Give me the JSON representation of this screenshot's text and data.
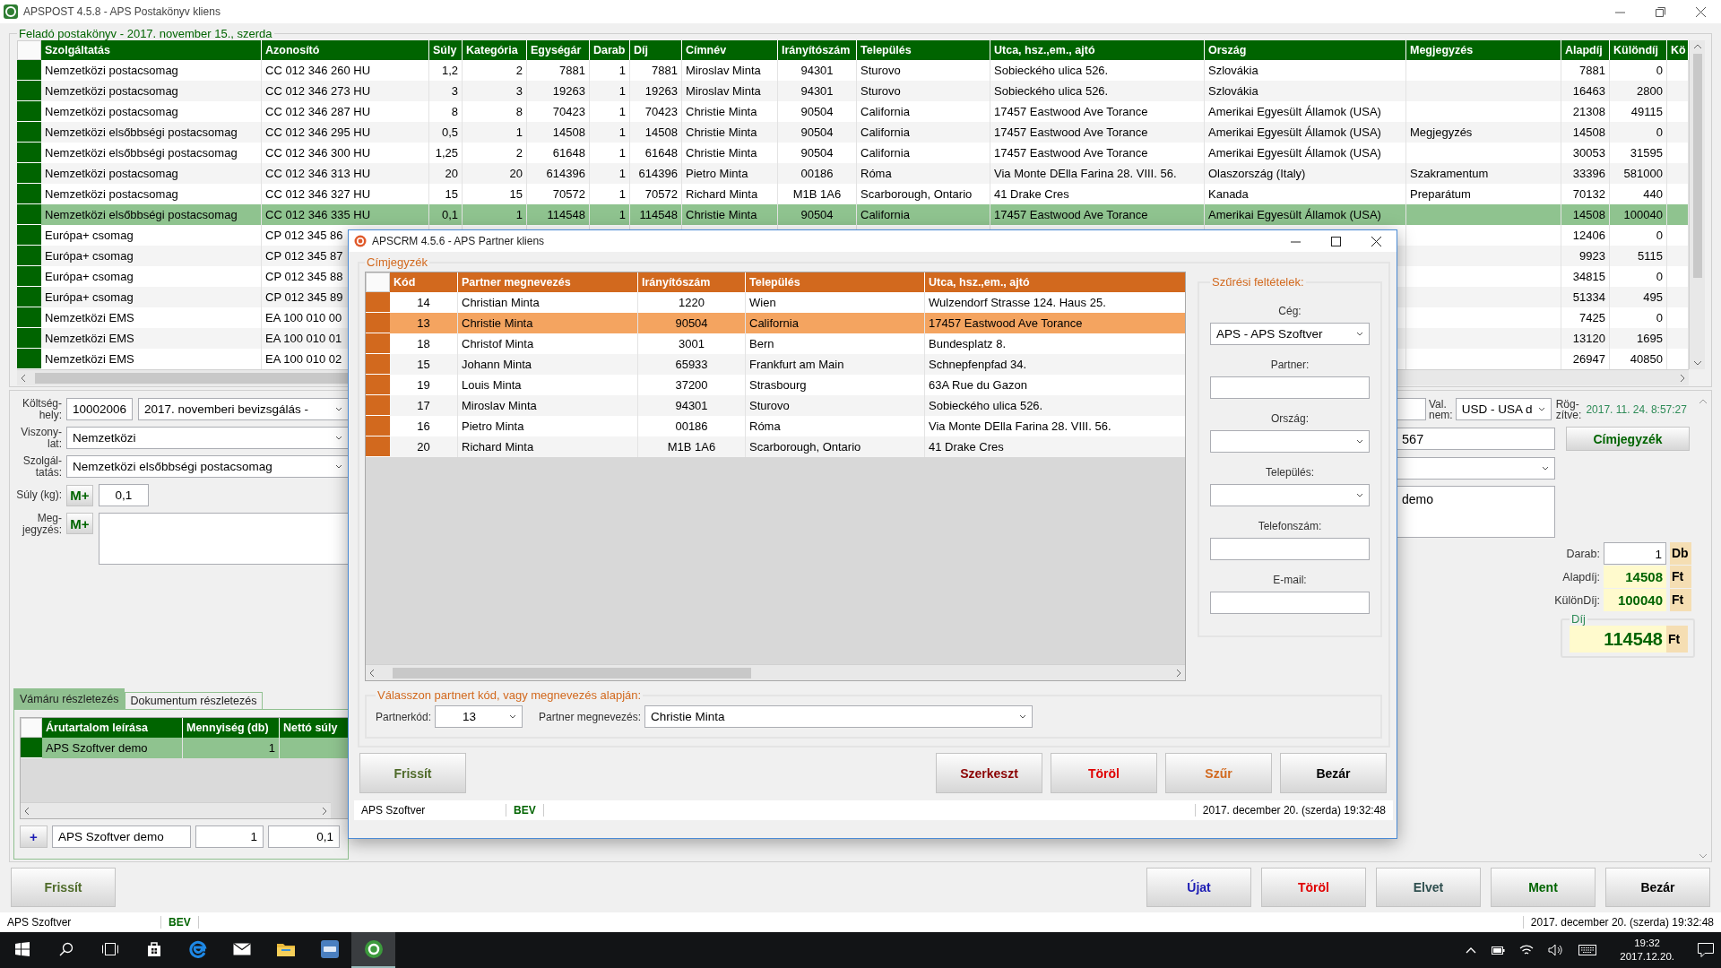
{
  "main": {
    "title": "APSPOST 4.5.8 - APS Postakönyv kliens",
    "ledger": {
      "title": "Feladó postakönyv - 2017. november 15., szerda",
      "columns": [
        "Szolgáltatás",
        "Azonosító",
        "Súly",
        "Kategória",
        "Egységár",
        "Darab",
        "Díj",
        "Címnév",
        "Irányítószám",
        "Település",
        "Utca, hsz.,em., ajtó",
        "Ország",
        "Megjegyzés",
        "Alapdíj",
        "Különdíj",
        "Kö"
      ],
      "rows": [
        {
          "selected": false,
          "cells": [
            "Nemzetközi postacsomag",
            "CC 012 346 260 HU",
            "1,2",
            "2",
            "7881",
            "1",
            "7881",
            "Miroslav Minta",
            "94301",
            "Sturovo",
            "Sobieckého ulica 526.",
            "Szlovákia",
            null,
            "7881",
            "0"
          ]
        },
        {
          "selected": false,
          "cells": [
            "Nemzetközi postacsomag",
            "CC 012 346 273 HU",
            "3",
            "3",
            "19263",
            "1",
            "19263",
            "Miroslav Minta",
            "94301",
            "Sturovo",
            "Sobieckého ulica 526.",
            "Szlovákia",
            null,
            "16463",
            "2800"
          ]
        },
        {
          "selected": false,
          "cells": [
            "Nemzetközi postacsomag",
            "CC 012 346 287 HU",
            "8",
            "8",
            "70423",
            "1",
            "70423",
            "Christie Minta",
            "90504",
            "California",
            "17457 Eastwood Ave Torance",
            "Amerikai Egyesült Államok (USA)",
            null,
            "21308",
            "49115"
          ]
        },
        {
          "selected": false,
          "cells": [
            "Nemzetközi elsőbbségi postacsomag",
            "CC 012 346 295 HU",
            "0,5",
            "1",
            "14508",
            "1",
            "14508",
            "Christie Minta",
            "90504",
            "California",
            "17457 Eastwood Ave Torance",
            "Amerikai Egyesült Államok (USA)",
            "Megjegyzés",
            "14508",
            "0"
          ]
        },
        {
          "selected": false,
          "cells": [
            "Nemzetközi elsőbbségi postacsomag",
            "CC 012 346 300 HU",
            "1,25",
            "2",
            "61648",
            "1",
            "61648",
            "Christie Minta",
            "90504",
            "California",
            "17457 Eastwood Ave Torance",
            "Amerikai Egyesült Államok (USA)",
            null,
            "30053",
            "31595"
          ]
        },
        {
          "selected": false,
          "cells": [
            "Nemzetközi postacsomag",
            "CC 012 346 313 HU",
            "20",
            "20",
            "614396",
            "1",
            "614396",
            "Pietro Minta",
            "00186",
            "Róma",
            "Via Monte DElla Farina 28. VIII. 56.",
            "Olaszország (Italy)",
            "Szakramentum",
            "33396",
            "581000"
          ]
        },
        {
          "selected": false,
          "cells": [
            "Nemzetközi postacsomag",
            "CC 012 346 327 HU",
            "15",
            "15",
            "70572",
            "1",
            "70572",
            "Richard Minta",
            "M1B 1A6",
            "Scarborough, Ontario",
            "41 Drake Cres",
            "Kanada",
            "Preparátum",
            "70132",
            "440"
          ]
        },
        {
          "selected": true,
          "cells": [
            "Nemzetközi elsőbbségi postacsomag",
            "CC 012 346 335 HU",
            "0,1",
            "1",
            "114548",
            "1",
            "114548",
            "Christie Minta",
            "90504",
            "California",
            "17457 Eastwood Ave Torance",
            "Amerikai Egyesült Államok (USA)",
            null,
            "14508",
            "100040"
          ]
        },
        {
          "selected": false,
          "cells": [
            "Európa+ csomag",
            "CP 012 345 86",
            null,
            null,
            null,
            null,
            null,
            null,
            null,
            null,
            null,
            null,
            null,
            "12406",
            "0"
          ]
        },
        {
          "selected": false,
          "cells": [
            "Európa+ csomag",
            "CP 012 345 87",
            null,
            null,
            null,
            null,
            null,
            null,
            null,
            null,
            null,
            null,
            null,
            "9923",
            "5115"
          ]
        },
        {
          "selected": false,
          "cells": [
            "Európa+ csomag",
            "CP 012 345 88",
            null,
            null,
            null,
            null,
            null,
            null,
            null,
            null,
            null,
            null,
            null,
            "34815",
            "0"
          ]
        },
        {
          "selected": false,
          "cells": [
            "Európa+ csomag",
            "CP 012 345 89",
            null,
            null,
            null,
            null,
            null,
            null,
            null,
            null,
            null,
            null,
            null,
            "51334",
            "495"
          ]
        },
        {
          "selected": false,
          "cells": [
            "Nemzetközi EMS",
            "EA 100 010 00",
            null,
            null,
            null,
            null,
            null,
            null,
            null,
            null,
            null,
            null,
            null,
            "7425",
            "0"
          ]
        },
        {
          "selected": false,
          "cells": [
            "Nemzetközi EMS",
            "EA 100 010 01",
            null,
            null,
            null,
            null,
            null,
            null,
            null,
            null,
            null,
            null,
            null,
            "13120",
            "1695"
          ]
        },
        {
          "selected": false,
          "cells": [
            "Nemzetközi EMS",
            "EA 100 010 02",
            null,
            null,
            null,
            null,
            null,
            null,
            null,
            null,
            null,
            null,
            null,
            "26947",
            "40850"
          ]
        }
      ]
    },
    "form": {
      "cost_center": {
        "label": "Költség-\nhely:",
        "code": "10002006",
        "value": "2017. novemberi bevizsgálás -"
      },
      "relation": {
        "label": "Viszony-\nlat:",
        "value": "Nemzetközi"
      },
      "service": {
        "label": "Szolgál-\ntatás:",
        "value": "Nemzetközi elsőbbségi postacsomag"
      },
      "weight": {
        "label": "Súly (kg):",
        "button": "M+",
        "value": "0,1"
      },
      "note": {
        "label": "Meg-\njegyzés:",
        "button": "M+"
      },
      "tabs": [
        {
          "label": "Vámáru részletezés",
          "selected": true
        },
        {
          "label": "Dokumentum részletezés",
          "selected": false
        }
      ],
      "customs_table": {
        "columns": [
          "Árutartalom leírása",
          "Mennyiség (db)",
          "Nettó súly"
        ],
        "rows": [
          {
            "selected": true,
            "cells": [
              "APS Szoftver demo",
              "1"
            ]
          }
        ]
      },
      "customs_entry": {
        "add_button": "+",
        "description": "APS Szoftver demo",
        "quantity": "1",
        "weight": "0,1"
      },
      "currency": {
        "label": "Val.\nnem:",
        "value": "USD - USA d"
      },
      "recorded": {
        "label": "Rög-\nzítve:",
        "value": "2017. 11. 24. 8:57:27"
      },
      "address_field": "567",
      "address_book_button": "Címjegyzék",
      "note_text": "demo",
      "count": {
        "label": "Darab:",
        "value": "1",
        "unit": "Db"
      },
      "base_fee": {
        "label": "Alapdíj:",
        "value": "14508",
        "unit": "Ft"
      },
      "extra_fee": {
        "label": "KülönDíj:",
        "value": "100040",
        "unit": "Ft"
      },
      "fee": {
        "legend": "Díj",
        "value": "114548",
        "unit": "Ft"
      }
    },
    "refresh_button": {
      "label": "Frissít",
      "color": "#4f6b2a"
    },
    "buttons": [
      {
        "label": "Újat",
        "color": "#1c1cb4"
      },
      {
        "label": "Töröl",
        "color": "#e00000"
      },
      {
        "label": "Elvet",
        "color": "#2f4f4f"
      },
      {
        "label": "Ment",
        "color": "#006400"
      },
      {
        "label": "Bezár",
        "color": "#000000"
      }
    ],
    "status_bar": [
      "APS Szoftver",
      "BEV",
      "2017. december 20. (szerda) 19:32:48"
    ]
  },
  "dialog": {
    "title": "APSCRM 4.5.6 - APS Partner kliens",
    "group": "Címjegyzék",
    "columns": [
      "Kód",
      "Partner megnevezés",
      "Irányítószám",
      "Település",
      "Utca, hsz.,em., ajtó"
    ],
    "rows": [
      {
        "selected": false,
        "cells": [
          "14",
          "Christian Minta",
          "1220",
          "Wien",
          "Wulzendorf Strasse 124. Haus 25."
        ]
      },
      {
        "selected": true,
        "cells": [
          "13",
          "Christie Minta",
          "90504",
          "California",
          "17457 Eastwood Ave Torance"
        ]
      },
      {
        "selected": false,
        "cells": [
          "18",
          "Christof Minta",
          "3001",
          "Bern",
          "Bundesplatz 8."
        ]
      },
      {
        "selected": false,
        "cells": [
          "15",
          "Johann Minta",
          "65933",
          "Frankfurt am Main",
          "Schnepfenpfad 34."
        ]
      },
      {
        "selected": false,
        "cells": [
          "19",
          "Louis Minta",
          "37200",
          "Strasbourg",
          "63A Rue du Gazon"
        ]
      },
      {
        "selected": false,
        "cells": [
          "17",
          "Miroslav Minta",
          "94301",
          "Sturovo",
          "Sobieckého ulica 526."
        ]
      },
      {
        "selected": false,
        "cells": [
          "16",
          "Pietro Minta",
          "00186",
          "Róma",
          "Via Monte DElla Farina 28. VIII. 56."
        ]
      },
      {
        "selected": false,
        "cells": [
          "20",
          "Richard Minta",
          "M1B 1A6",
          "Scarborough, Ontario",
          "41 Drake Cres"
        ]
      }
    ],
    "filter": {
      "legend": "Szűrési feltételek:",
      "fields": [
        {
          "label": "Cég:",
          "kind": "dropdown",
          "value": "APS - APS Szoftver"
        },
        {
          "label": "Partner:",
          "kind": "text"
        },
        {
          "label": "Ország:",
          "kind": "dropdown"
        },
        {
          "label": "Település:",
          "kind": "dropdown"
        },
        {
          "label": "Telefonszám:",
          "kind": "text"
        },
        {
          "label": "E-mail:",
          "kind": "text"
        }
      ]
    },
    "picker": {
      "legend": "Válasszon partnert kód, vagy megnevezés alapján:",
      "code_label": "Partnerkód:",
      "code": "13",
      "name_label": "Partner megnevezés:",
      "name": "Christie Minta"
    },
    "refresh_button": {
      "label": "Frissít",
      "color": "#4f6b2a"
    },
    "buttons": [
      {
        "label": "Szerkeszt",
        "color": "#8b0000"
      },
      {
        "label": "Töröl",
        "color": "#e00000"
      },
      {
        "label": "Szűr",
        "color": "#d2691e"
      },
      {
        "label": "Bezár",
        "color": "#000000"
      }
    ],
    "status_bar": [
      "APS Szoftver",
      "BEV",
      "2017. december 20. (szerda) 19:32:48"
    ]
  },
  "taskbar": {
    "apps": [
      {
        "kind": "start",
        "active": false
      },
      {
        "kind": "search",
        "active": false
      },
      {
        "kind": "task_view",
        "active": false
      },
      {
        "kind": "store",
        "active": false
      },
      {
        "kind": "browser",
        "active": false
      },
      {
        "kind": "mail",
        "active": false
      },
      {
        "kind": "folder",
        "active": false
      },
      {
        "kind": "aps",
        "active": false
      },
      {
        "kind": "post",
        "active": true
      }
    ],
    "clock": {
      "time": "19:32",
      "date": "2017.12.20."
    }
  }
}
